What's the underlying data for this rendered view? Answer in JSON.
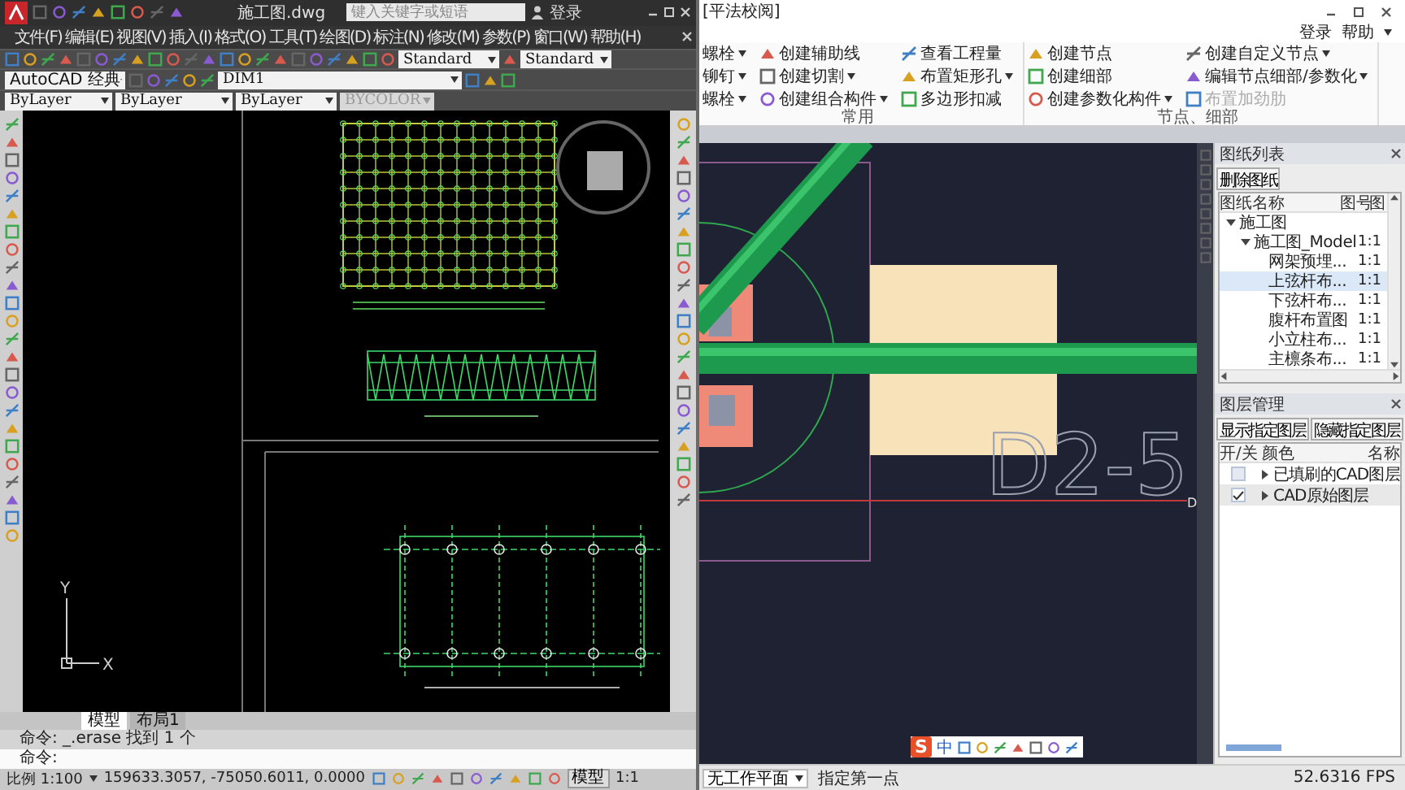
{
  "cad_window": {
    "title": "施工图.dwg",
    "search": {
      "placeholder": "键入关键字或短语"
    },
    "login": "登录",
    "menu": [
      "文件(F)",
      "编辑(E)",
      "视图(V)",
      "插入(I)",
      "格式(O)",
      "工具(T)",
      "绘图(D)",
      "标注(N)",
      "修改(M)",
      "参数(P)",
      "窗口(W)",
      "帮助(H)"
    ],
    "style_selects": [
      "Standard",
      "Standard"
    ],
    "workspace": "AutoCAD 经典",
    "layer": "DIM1",
    "properties": [
      "ByLayer",
      "ByLayer",
      "ByLayer",
      "BYCOLOR"
    ],
    "ucs": {
      "x": "X",
      "y": "Y"
    },
    "layout_tabs": [
      {
        "label": "模型",
        "selected": true
      },
      {
        "label": "布局1",
        "selected": false
      }
    ],
    "command_lines": [
      "命令: _.erase 找到 1 个",
      "命令:"
    ],
    "status": {
      "scale": "比例 1:100",
      "coordinates": "159633.3057, -75050.6011, 0.0000",
      "model": "模型",
      "annotation_scale": "1:1"
    }
  },
  "tekla_window": {
    "title": "[平法校阅]",
    "login": "登录",
    "help": "帮助",
    "ribbon": [
      {
        "label": "常用",
        "columns": [
          [
            {
              "label": "螺栓",
              "dropdown": true,
              "disabled": false
            },
            {
              "label": "铆钉",
              "dropdown": true,
              "disabled": false
            },
            {
              "label": "螺栓",
              "dropdown": true,
              "disabled": false
            }
          ],
          [
            {
              "label": "创建辅助线",
              "dropdown": false,
              "disabled": false
            },
            {
              "label": "创建切割",
              "dropdown": true,
              "disabled": false
            },
            {
              "label": "创建组合构件",
              "dropdown": true,
              "disabled": false
            }
          ],
          [
            {
              "label": "查看工程量",
              "dropdown": false,
              "disabled": false
            },
            {
              "label": "布置矩形孔",
              "dropdown": true,
              "disabled": false
            },
            {
              "label": "多边形扣减",
              "dropdown": false,
              "disabled": false
            }
          ]
        ]
      },
      {
        "label": "节点、细部",
        "columns": [
          [
            {
              "label": "创建节点",
              "dropdown": false,
              "disabled": false
            },
            {
              "label": "创建细部",
              "dropdown": false,
              "disabled": false
            },
            {
              "label": "创建参数化构件",
              "dropdown": true,
              "disabled": false
            }
          ],
          [
            {
              "label": "创建自定义节点",
              "dropdown": true,
              "disabled": false
            },
            {
              "label": "编辑节点细部/参数化",
              "dropdown": true,
              "disabled": false
            },
            {
              "label": "布置加劲肋",
              "dropdown": false,
              "disabled": true
            }
          ]
        ]
      }
    ],
    "canvas": {
      "label": "D2-5",
      "axis_mark": "D"
    },
    "ime": {
      "logo": "S",
      "mode": "中"
    },
    "sheet_list": {
      "title": "图纸列表",
      "delete_button": "删除图纸",
      "columns": [
        "图纸名称",
        "图号",
        "图"
      ],
      "tree": [
        {
          "name": "施工图",
          "selected": false,
          "expanded": true,
          "children": [
            {
              "name": "施工图_Model",
              "scale": "1:1",
              "selected": false,
              "expanded": true,
              "children": [
                {
                  "name": "网架预埋...",
                  "scale": "1:1",
                  "selected": false
                },
                {
                  "name": "上弦杆布...",
                  "scale": "1:1",
                  "selected": true
                },
                {
                  "name": "下弦杆布...",
                  "scale": "1:1",
                  "selected": false
                },
                {
                  "name": "腹杆布置图",
                  "scale": "1:1",
                  "selected": false
                },
                {
                  "name": "小立柱布...",
                  "scale": "1:1",
                  "selected": false
                },
                {
                  "name": "主檩条布...",
                  "scale": "1:1",
                  "selected": false
                }
              ]
            }
          ]
        }
      ]
    },
    "layer_panel": {
      "title": "图层管理",
      "buttons": [
        "显示指定图层",
        "隐藏指定图层"
      ],
      "columns": [
        "开/关",
        "颜色",
        "名称"
      ],
      "rows": [
        {
          "name": "已填刷的CAD图层",
          "checked": false
        },
        {
          "name": "CAD原始图层",
          "checked": true
        }
      ]
    },
    "status": {
      "workplane": "无工作平面",
      "prompt": "指定第一点",
      "fps": "52.6316 FPS"
    }
  }
}
